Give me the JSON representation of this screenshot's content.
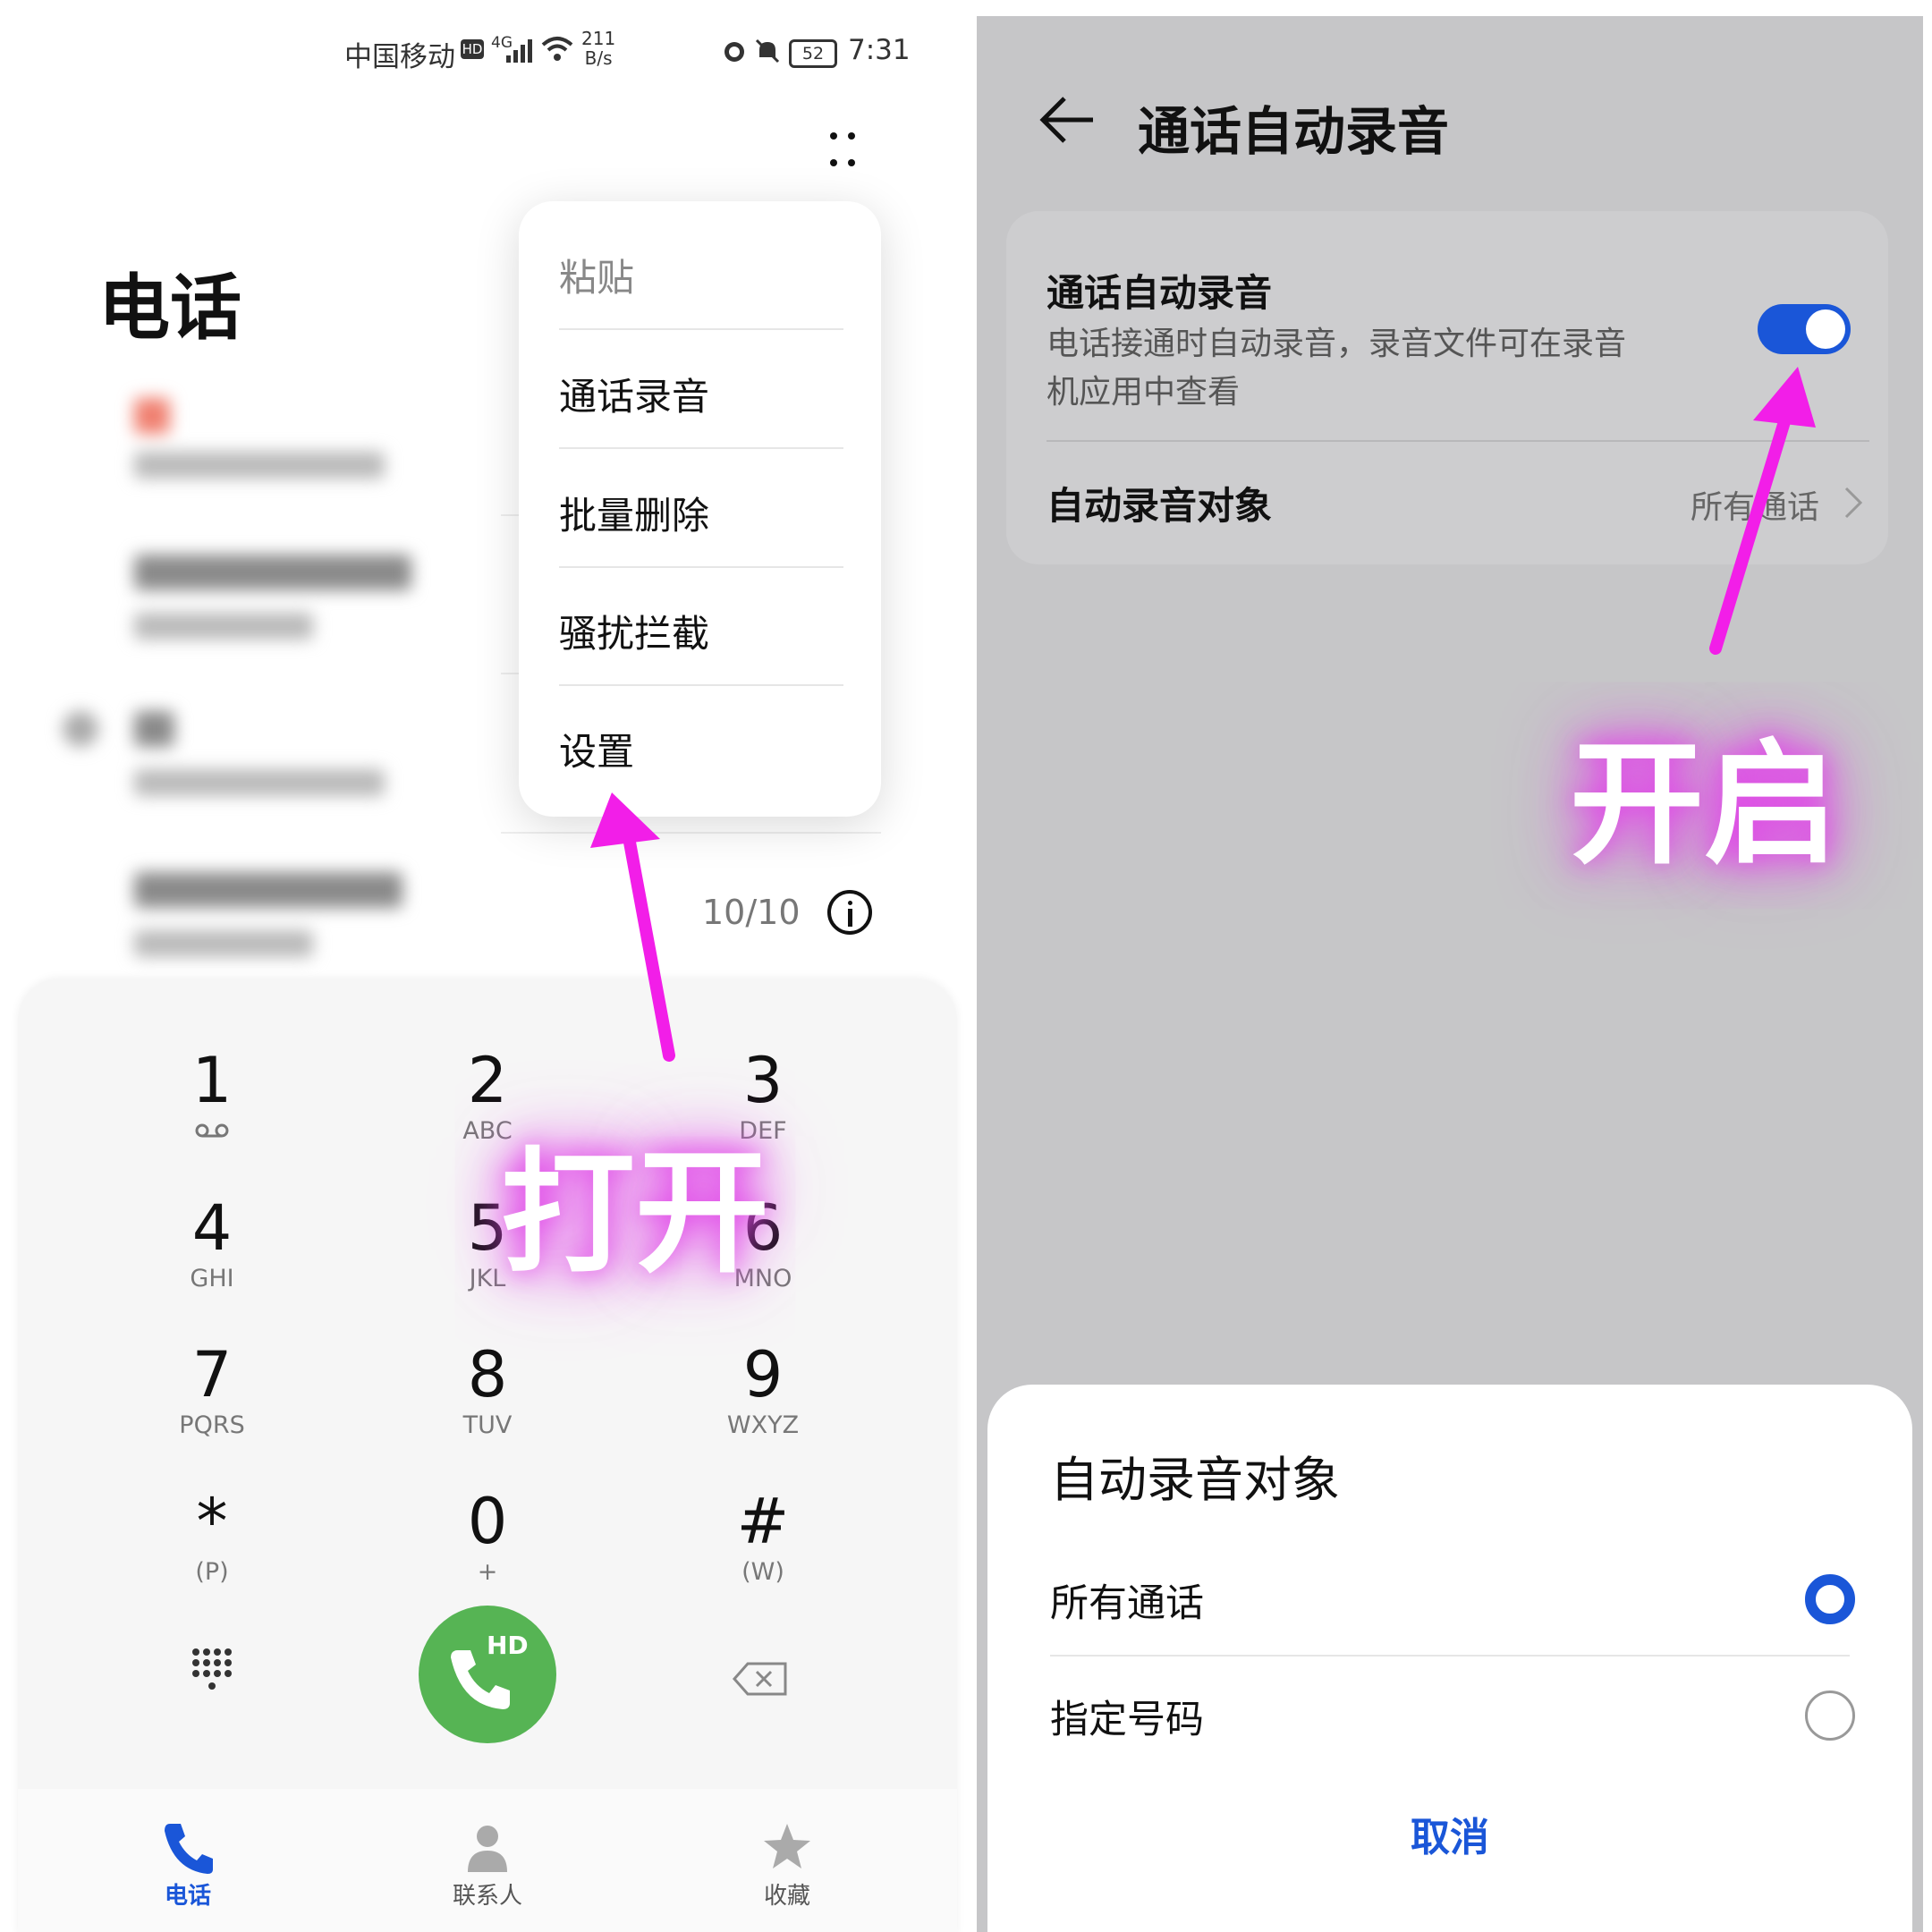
{
  "left": {
    "status_bar": {
      "carrier": "中国移动",
      "hd_badge": "HD",
      "network": "4G",
      "speed_value": "211",
      "speed_unit": "B/s",
      "battery": "52",
      "time": "7:31"
    },
    "page_title": "电话",
    "menu": {
      "items": [
        "粘贴",
        "通话录音",
        "批量删除",
        "骚扰拦截",
        "设置"
      ]
    },
    "call_log_count": "10/10",
    "keypad": {
      "keys": [
        {
          "digit": "1",
          "letters": "voicemail"
        },
        {
          "digit": "2",
          "letters": "ABC"
        },
        {
          "digit": "3",
          "letters": "DEF"
        },
        {
          "digit": "4",
          "letters": "GHI"
        },
        {
          "digit": "5",
          "letters": "JKL"
        },
        {
          "digit": "6",
          "letters": "MNO"
        },
        {
          "digit": "7",
          "letters": "PQRS"
        },
        {
          "digit": "8",
          "letters": "TUV"
        },
        {
          "digit": "9",
          "letters": "WXYZ"
        },
        {
          "digit": "*",
          "letters": "(P)"
        },
        {
          "digit": "0",
          "letters": "+"
        },
        {
          "digit": "#",
          "letters": "(W)"
        }
      ],
      "call_badge": "HD"
    },
    "tabs": [
      "电话",
      "联系人",
      "收藏"
    ],
    "annotation": "打开"
  },
  "right": {
    "title": "通话自动录音",
    "setting": {
      "title": "通话自动录音",
      "description_line1": "电话接通时自动录音，录音文件可在录音",
      "description_line2": "机应用中查看",
      "enabled": true
    },
    "target_row": {
      "label": "自动录音对象",
      "value": "所有通话"
    },
    "sheet": {
      "title": "自动录音对象",
      "options": [
        {
          "label": "所有通话",
          "selected": true
        },
        {
          "label": "指定号码",
          "selected": false
        }
      ],
      "cancel": "取消"
    },
    "annotation": "开启"
  },
  "colors": {
    "accent_blue": "#1a56d8",
    "call_green": "#56b454",
    "annotation_magenta": "#f21ee8"
  }
}
